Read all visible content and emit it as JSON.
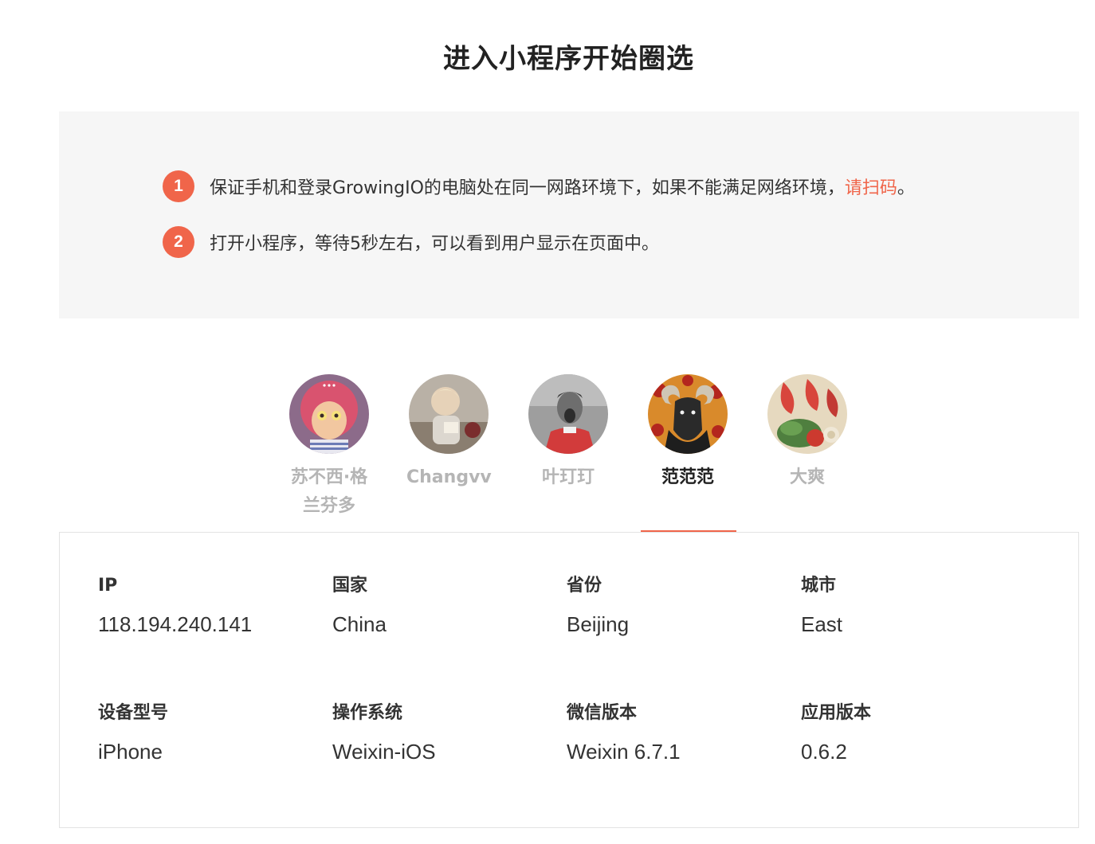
{
  "title": "进入小程序开始圈选",
  "colors": {
    "accent": "#f0654a",
    "panel_bg": "#f6f6f6",
    "inactive_name": "#b5b5b5"
  },
  "steps": [
    {
      "number": "1",
      "text": "保证手机和登录GrowingIO的电脑处在同一网路环境下，如果不能满足网络环境，",
      "link": "请扫码",
      "suffix": "。"
    },
    {
      "number": "2",
      "text": "打开小程序，等待5秒左右，可以看到用户显示在页面中。"
    }
  ],
  "users": [
    {
      "name": "苏不西·格兰芬多",
      "avatar_icon": "cartoon-girl-avatar-icon",
      "active": false
    },
    {
      "name": "Changvv",
      "avatar_icon": "child-photo-avatar-icon",
      "active": false
    },
    {
      "name": "叶玎玎",
      "avatar_icon": "footballer-photo-avatar-icon",
      "active": false
    },
    {
      "name": "范范范",
      "avatar_icon": "ram-pizza-avatar-icon",
      "active": true
    },
    {
      "name": "大爽",
      "avatar_icon": "food-photo-avatar-icon",
      "active": false
    }
  ],
  "details": {
    "ip": {
      "label": "IP",
      "value": "118.194.240.141"
    },
    "country": {
      "label": "国家",
      "value": "China"
    },
    "province": {
      "label": "省份",
      "value": "Beijing"
    },
    "city": {
      "label": "城市",
      "value": "East"
    },
    "device_model": {
      "label": "设备型号",
      "value": "iPhone"
    },
    "os": {
      "label": "操作系统",
      "value": "Weixin-iOS"
    },
    "wechat_version": {
      "label": "微信版本",
      "value": "Weixin 6.7.1"
    },
    "app_version": {
      "label": "应用版本",
      "value": "0.6.2"
    }
  }
}
